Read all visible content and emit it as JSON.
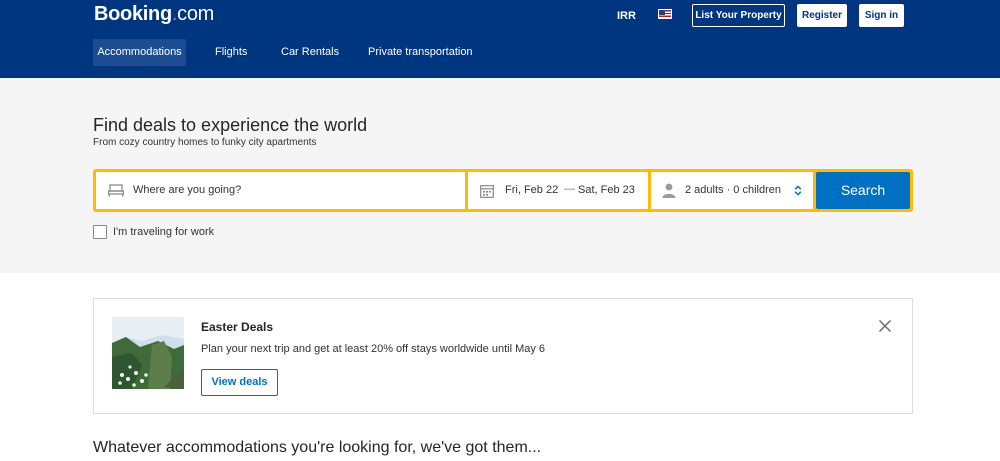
{
  "header": {
    "logo_main": "Booking",
    "logo_dot": ".",
    "logo_com": "com",
    "currency": "IRR",
    "flag_icon": "us-flag-icon",
    "list_property_label": "List Your Property",
    "register_label": "Register",
    "signin_label": "Sign in",
    "bg_color": "#003580"
  },
  "nav": {
    "tabs": [
      {
        "label": "Accommodations",
        "active": true
      },
      {
        "label": "Flights",
        "active": false
      },
      {
        "label": "Car Rentals",
        "active": false
      },
      {
        "label": "Private transportation",
        "active": false
      }
    ]
  },
  "hero": {
    "title": "Find deals to experience the world",
    "subtitle": "From cozy country homes to funky city apartments"
  },
  "search": {
    "destination_placeholder": "Where are you going?",
    "destination_icon": "bed-icon",
    "checkin": "Fri, Feb 22",
    "date_separator": "—",
    "checkout": "Sat, Feb 23",
    "calendar_icon": "calendar-icon",
    "guests": "2 adults · 0 children",
    "guests_icon": "person-icon",
    "guests_chevron_icon": "up-down-chevron-icon",
    "button_label": "Search",
    "border_color": "#febb02",
    "button_color": "#0071c2",
    "work_travel_label": "I'm traveling for work",
    "work_travel_checked": false
  },
  "deals": {
    "title": "Easter Deals",
    "description": "Plan your next trip and get at least 20% off stays worldwide until May 6",
    "button_label": "View deals",
    "close_icon": "close-icon"
  },
  "section": {
    "title": "Whatever accommodations you're looking for, we've got them..."
  }
}
